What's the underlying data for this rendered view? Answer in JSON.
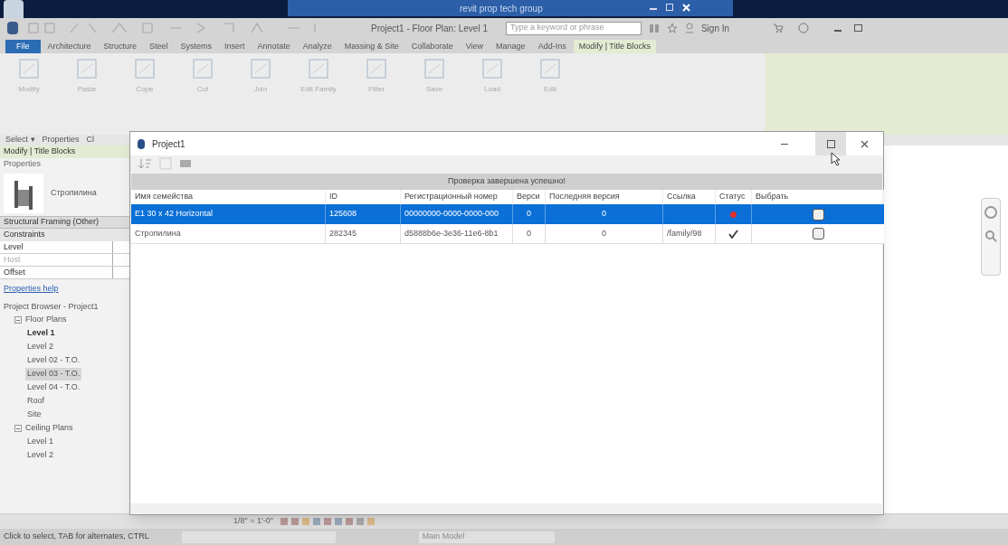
{
  "window": {
    "title": "revit prop tech group"
  },
  "quick_access": {
    "document_title": "Project1 - Floor Plan: Level 1",
    "search": {
      "placeholder": "Type a keyword or phrase"
    },
    "sign_in": "Sign In"
  },
  "ribbon_tabs": [
    {
      "label": "File",
      "kind": "file",
      "selected": false
    },
    {
      "label": "Architecture",
      "kind": "tab",
      "selected": false
    },
    {
      "label": "Structure",
      "kind": "tab",
      "selected": false
    },
    {
      "label": "Steel",
      "kind": "tab",
      "selected": false
    },
    {
      "label": "Systems",
      "kind": "tab",
      "selected": false
    },
    {
      "label": "Insert",
      "kind": "tab",
      "selected": false
    },
    {
      "label": "Annotate",
      "kind": "tab",
      "selected": false
    },
    {
      "label": "Analyze",
      "kind": "tab",
      "selected": false
    },
    {
      "label": "Massing & Site",
      "kind": "tab",
      "selected": false
    },
    {
      "label": "Collaborate",
      "kind": "tab",
      "selected": false
    },
    {
      "label": "View",
      "kind": "tab",
      "selected": false
    },
    {
      "label": "Manage",
      "kind": "tab",
      "selected": false
    },
    {
      "label": "Add-Ins",
      "kind": "tab",
      "selected": false
    },
    {
      "label": "Modify | Title Blocks",
      "kind": "tab",
      "selected": true
    }
  ],
  "ribbon": {
    "buttons": [
      "Modify",
      "Paste",
      "Cope",
      "Cut",
      "Join",
      "Edit Family",
      "Filter",
      "Save",
      "Load",
      "Edit"
    ],
    "panel_labels": [
      "Select ▾",
      "Properties",
      "Cl"
    ]
  },
  "properties": {
    "context": "Modify | Title Blocks",
    "title": "Properties",
    "type_name": "Стропилина",
    "category": "Structural Framing (Other)",
    "group": "Constraints",
    "rows": [
      {
        "name": "Level",
        "disabled": false
      },
      {
        "name": "Host",
        "disabled": true
      },
      {
        "name": "Offset",
        "disabled": false
      }
    ],
    "help_link": "Properties help"
  },
  "project_browser": {
    "title": "Project Browser - Project1",
    "children": [
      {
        "label": "Floor Plans",
        "expanded": true,
        "children": [
          {
            "label": "Level 1",
            "current": true,
            "selected": false
          },
          {
            "label": "Level 2",
            "current": false,
            "selected": false
          },
          {
            "label": "Level 02 - T.O.",
            "current": false,
            "selected": false
          },
          {
            "label": "Level 03 - T.O.",
            "current": false,
            "selected": true
          },
          {
            "label": "Level 04 - T.O.",
            "current": false,
            "selected": false
          },
          {
            "label": "Roof",
            "current": false,
            "selected": false
          },
          {
            "label": "Site",
            "current": false,
            "selected": false
          }
        ]
      },
      {
        "label": "Ceiling Plans",
        "expanded": true,
        "children": [
          {
            "label": "Level 1",
            "current": false,
            "selected": false
          },
          {
            "label": "Level 2",
            "current": false,
            "selected": false
          }
        ]
      }
    ]
  },
  "dialog": {
    "title": "Project1",
    "message": "Проверка завершена успешно!",
    "table": {
      "columns": [
        "Имя семейства",
        "ID",
        "Регистрационный номер",
        "Верси",
        "Последняя версия",
        "Ссылка",
        "Статус",
        "Выбрать"
      ],
      "rows": [
        {
          "selected": true,
          "cells": [
            "E1 30 x 42 Horizontal",
            "125608",
            "00000000-0000-0000-000",
            "0",
            "0",
            ""
          ],
          "kind": "error"
        },
        {
          "selected": false,
          "cells": [
            "Стропилина",
            "282345",
            "d5888b6e-3e36-11e6-8b1",
            "0",
            "0",
            "/family/98"
          ],
          "kind": "ok"
        }
      ]
    }
  },
  "view_bar": {
    "scale": "1/8\" = 1'-0\""
  },
  "status_bar": {
    "hint": "Click to select, TAB for alternates, CTRL",
    "model": "Main Model"
  }
}
